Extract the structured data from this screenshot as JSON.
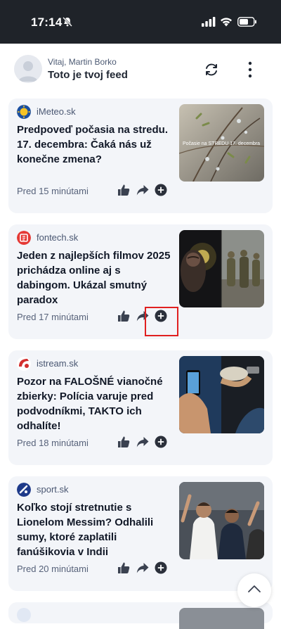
{
  "status_bar": {
    "time": "17:14"
  },
  "header": {
    "greeting": "Vitaj, Martin Borko",
    "feed_title": "Toto je tvoj feed"
  },
  "articles": [
    {
      "source": "iMeteo.sk",
      "title": "Predpoveď počasia na stredu. 17. decembra: Čaká nás už konečne zmena?",
      "time_ago": "Pred 15 minútami",
      "thumb_caption": "Počasie na STREDU 17. decembra",
      "icon_color": "#1a4fa0"
    },
    {
      "source": "fontech.sk",
      "title": "Jeden z najlepších filmov 2025 prichádza online aj s dabingom. Ukázal smutný paradox",
      "time_ago": "Pred 17 minútami",
      "icon_color": "#e53935"
    },
    {
      "source": "istream.sk",
      "title": "Pozor na FALOŠNÉ vianočné zbierky: Polícia varuje pred podvodníkmi, TAKTO ich odhalíte!",
      "time_ago": "Pred 18 minútami",
      "icon_color": "#d32f2f"
    },
    {
      "source": "sport.sk",
      "title": "Koľko stojí stretnutie s Lionelom Messim? Odhalili sumy, ktoré zaplatili fanúšikovia v Indii",
      "time_ago": "Pred 20 minútami",
      "icon_color": "#1e3a8a"
    }
  ],
  "colors": {
    "card_bg": "#f3f5f9",
    "highlight": "#e02020",
    "status_bar_bg": "#1f2329"
  },
  "icons": [
    "bell-slash-icon",
    "signal-icon",
    "wifi-icon",
    "battery-icon",
    "refresh-icon",
    "more-vertical-icon",
    "thumbs-up-icon",
    "share-icon",
    "plus-circle-icon",
    "chevron-up-icon"
  ]
}
